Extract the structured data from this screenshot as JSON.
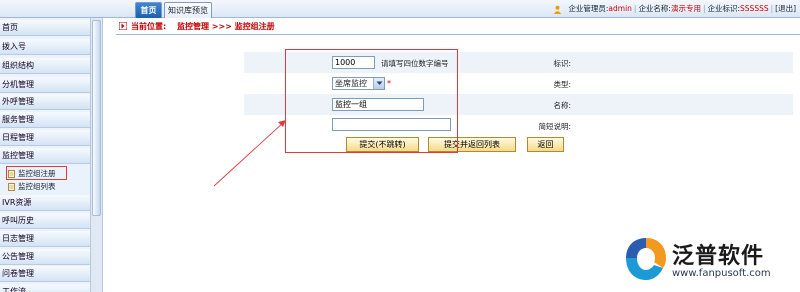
{
  "tabs": [
    {
      "label": "首页",
      "active": true
    },
    {
      "label": "知识库预览",
      "active": false
    }
  ],
  "userinfo": {
    "admin_label": "企业管理员:",
    "admin_value": "admin",
    "company_label": "企业名称:",
    "company_value": "演示专用",
    "company_id_label": "企业标识:",
    "company_id_value": "SSSSSS",
    "exit_label": "[退出]",
    "separator": "|"
  },
  "sidebar": {
    "items": [
      {
        "label": "首页"
      },
      {
        "label": "拨入号"
      },
      {
        "label": "组织结构"
      },
      {
        "label": "分机管理"
      },
      {
        "label": "外呼管理"
      },
      {
        "label": "服务管理"
      },
      {
        "label": "日程管理"
      },
      {
        "label": "监控管理"
      }
    ],
    "sub_items": [
      {
        "label": "监控组注册"
      },
      {
        "label": "监控组列表"
      }
    ],
    "items_after": [
      {
        "label": "IVR资源"
      },
      {
        "label": "呼叫历史"
      },
      {
        "label": "日志管理"
      },
      {
        "label": "公告管理"
      },
      {
        "label": "问卷管理"
      },
      {
        "label": "工作流"
      }
    ]
  },
  "location": {
    "label": "当前位置:",
    "path": "监控管理 >>> 监控组注册"
  },
  "form": {
    "id_label": "标识:",
    "id_value": "1000",
    "id_hint": "请填写四位数字编号",
    "type_label": "类型:",
    "type_value": "坐席监控",
    "required_mark": "*",
    "name_label": "名称:",
    "name_value": "监控一组",
    "desc_label": "简短说明:",
    "desc_value": ""
  },
  "buttons": {
    "submit": "提交(不跳转)",
    "submit_return": "提交并返回列表",
    "back": "返回"
  },
  "logo": {
    "text": "泛普软件",
    "url": "www.fanpusoft.com"
  },
  "colors": {
    "accent_red": "#e03a3a",
    "tab_active": "#1c5eae",
    "button_fill": "#f6d989"
  }
}
